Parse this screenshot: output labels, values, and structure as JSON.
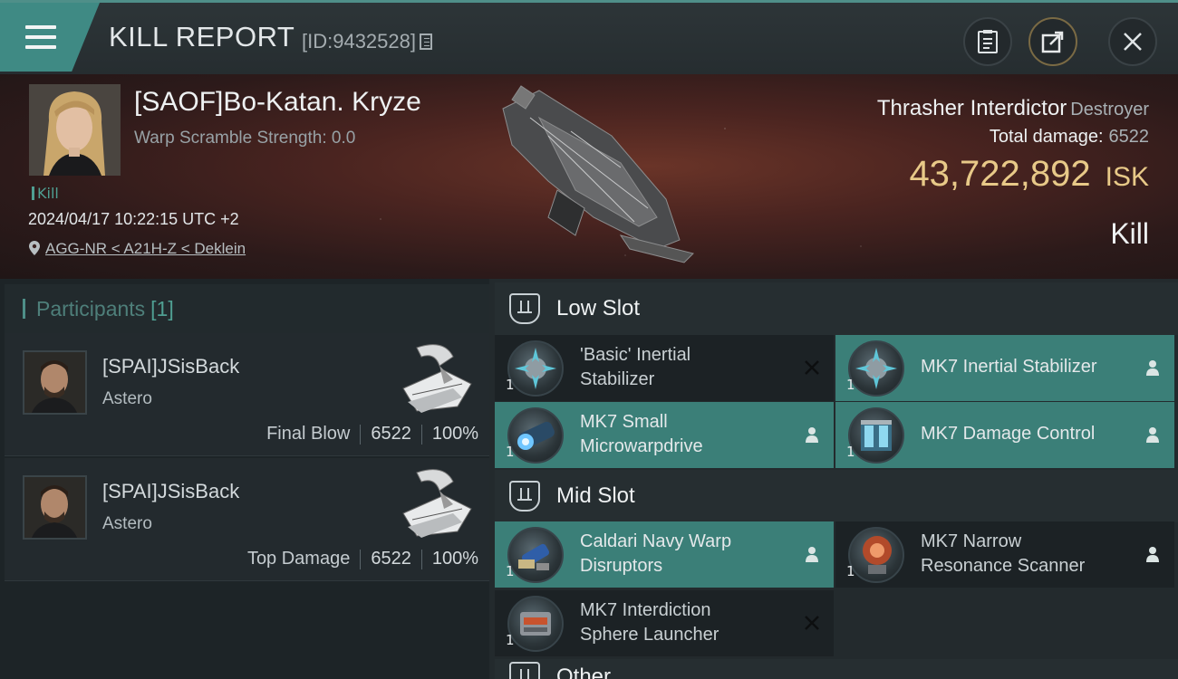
{
  "header": {
    "title": "KILL REPORT",
    "id_text": "[ID:9432528]"
  },
  "victim": {
    "name": "[SAOF]Bo-Katan. Kryze",
    "scramble": "Warp Scramble Strength: 0.0",
    "kill_tag": "Kill",
    "datetime": "2024/04/17 10:22:15 UTC +2",
    "location": "AGG-NR < A21H-Z < Deklein",
    "ship_name": "Thrasher Interdictor",
    "ship_class": "Destroyer",
    "total_damage_label": "Total damage:",
    "total_damage": "6522",
    "isk_value": "43,722,892",
    "isk_unit": "ISK",
    "result": "Kill"
  },
  "participants": {
    "label": "Participants",
    "count": "[1]",
    "items": [
      {
        "name": "[SPAI]JSisBack",
        "ship": "Astero",
        "role": "Final Blow",
        "damage": "6522",
        "percent": "100%"
      },
      {
        "name": "[SPAI]JSisBack",
        "ship": "Astero",
        "role": "Top Damage",
        "damage": "6522",
        "percent": "100%"
      }
    ]
  },
  "fitting": {
    "low_slot_label": "Low Slot",
    "mid_slot_label": "Mid Slot",
    "other_slot_label": "Other",
    "low": [
      {
        "qty": "1",
        "line1": "'Basic' Inertial",
        "line2": "Stabilizer",
        "status": "destroyed"
      },
      {
        "qty": "1",
        "line1": "MK7 Inertial Stabilizer",
        "line2": "",
        "status": "dropped"
      },
      {
        "qty": "1",
        "line1": "MK7 Small",
        "line2": "Microwarpdrive",
        "status": "dropped"
      },
      {
        "qty": "1",
        "line1": "MK7 Damage Control",
        "line2": "",
        "status": "dropped"
      }
    ],
    "mid": [
      {
        "qty": "1",
        "line1": "Caldari Navy Warp",
        "line2": "Disruptors",
        "status": "dropped"
      },
      {
        "qty": "1",
        "line1": "MK7 Narrow",
        "line2": "Resonance Scanner",
        "status": "dropped"
      },
      {
        "qty": "1",
        "line1": "MK7 Interdiction",
        "line2": "Sphere Launcher",
        "status": "destroyed"
      }
    ]
  },
  "colors": {
    "accent_teal": "#3f8a84",
    "isk_gold": "#e8c988",
    "hero_red": "#4a2420"
  },
  "icons": [
    "menu-icon",
    "copy-icon",
    "clipboard-icon",
    "share-icon",
    "close-icon",
    "pin-icon",
    "slot-icon",
    "destroyed-x-icon",
    "dropped-person-icon"
  ]
}
